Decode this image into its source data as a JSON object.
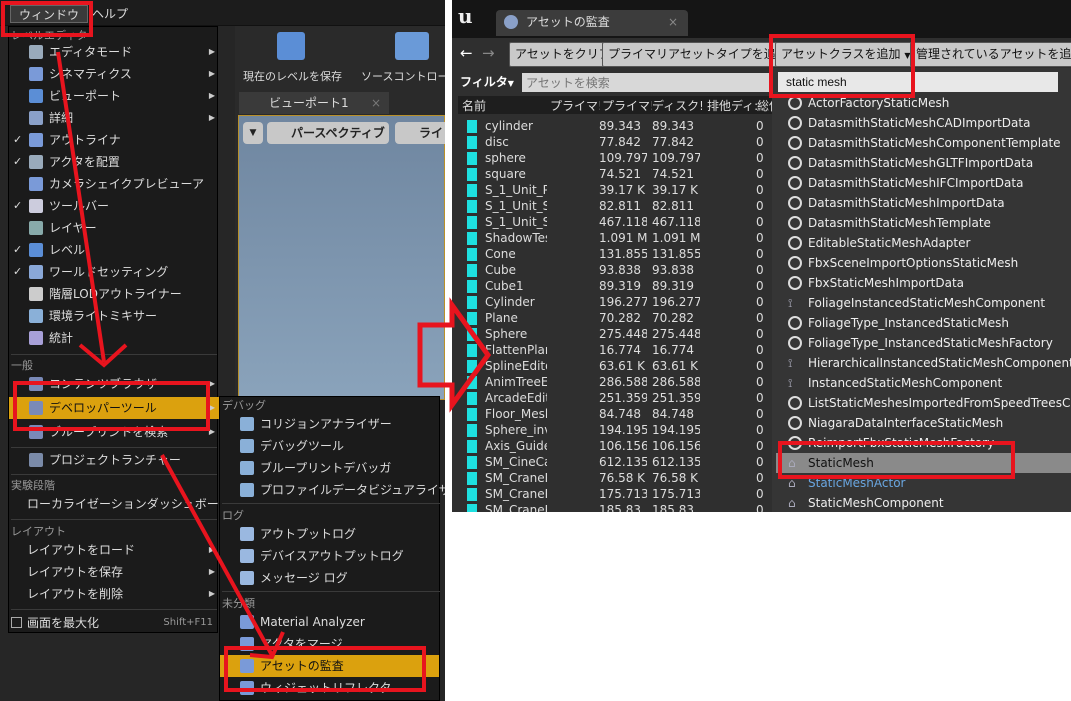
{
  "left": {
    "menubar": [
      "ウィンドウ",
      "ヘルプ"
    ],
    "toolbar": {
      "save": "現在のレベルを保存",
      "source": "ソースコントロー"
    },
    "viewport_tab": "ビューポート1",
    "viewport_buttons": [
      "パースペクティブ",
      "ライ"
    ],
    "menu": {
      "section_level_editor": "レベルエディタ",
      "items": [
        {
          "label": "エディタモード",
          "check": false,
          "submenu": true
        },
        {
          "label": "シネマティクス",
          "check": false,
          "submenu": true
        },
        {
          "label": "ビューポート",
          "check": false,
          "submenu": true
        },
        {
          "label": "詳細",
          "check": false,
          "submenu": true
        },
        {
          "label": "アウトライナ",
          "check": true,
          "submenu": false
        },
        {
          "label": "アクタを配置",
          "check": true,
          "submenu": false
        },
        {
          "label": "カメラシェイクプレビューア",
          "check": false,
          "submenu": false
        },
        {
          "label": "ツールバー",
          "check": true,
          "submenu": false
        },
        {
          "label": "レイヤー",
          "check": false,
          "submenu": false
        },
        {
          "label": "レベル",
          "check": true,
          "submenu": false
        },
        {
          "label": "ワールドセッティング",
          "check": true,
          "submenu": false
        },
        {
          "label": "階層LODアウトライナー",
          "check": false,
          "submenu": false
        },
        {
          "label": "環境ライトミキサー",
          "check": false,
          "submenu": false
        },
        {
          "label": "統計",
          "check": false,
          "submenu": false
        }
      ],
      "section_general": "一般",
      "general": [
        {
          "label": "コンテンツブラウザ"
        },
        {
          "label": "デベロッパーツール",
          "highlighted": true
        },
        {
          "label": "ブループリントを検索"
        }
      ],
      "project_launcher": "プロジェクトランチャー",
      "section_experimental": "実験段階",
      "localization": "ローカライゼーションダッシュボード",
      "section_layout": "レイアウト",
      "layout": [
        "レイアウトをロード",
        "レイアウトを保存",
        "レイアウトを削除"
      ],
      "maximize": "画面を最大化",
      "maximize_shortcut": "Shift+F11"
    },
    "submenu": {
      "section_debug": "デバッグ",
      "debug": [
        "コリジョンアナライザー",
        "デバッグツール",
        "ブループリントデバッガ",
        "プロファイルデータビジュアライザ"
      ],
      "section_log": "ログ",
      "log": [
        "アウトプットログ",
        "デバイスアウトプットログ",
        "メッセージ ログ"
      ],
      "section_misc": "未分類",
      "misc": [
        "Material Analyzer",
        "アクタをマージ",
        "アセットの監査",
        "ウィジェットリフレクタ"
      ]
    }
  },
  "right": {
    "tab_title": "アセットの監査",
    "buttons": [
      "アセットをクリア",
      "プライマリアセットタイプを追加",
      "アセットクラスを追加",
      "管理されているアセットを追加"
    ],
    "filter": "フィルタ",
    "search_placeholder": "アセットを検索",
    "columns": [
      "名前",
      "プライマ!",
      "プライマ!",
      "ディスク!",
      "排他ディ:",
      "総使"
    ],
    "rows": [
      [
        "cylinder",
        "89.343",
        "89.343",
        "0"
      ],
      [
        "disc",
        "77.842",
        "77.842",
        "0"
      ],
      [
        "sphere",
        "109.797",
        "109.797",
        "0"
      ],
      [
        "square",
        "74.521",
        "74.521",
        "0"
      ],
      [
        "S_1_Unit_Pl",
        "39.17 K",
        "39.17 K",
        "0"
      ],
      [
        "S_1_Unit_Sp",
        "82.811",
        "82.811",
        "0"
      ],
      [
        "S_1_Unit_Sp",
        "467.118",
        "467.118",
        "0"
      ],
      [
        "ShadowTes",
        "1.091 M",
        "1.091 M",
        "0"
      ],
      [
        "Cone",
        "131.855",
        "131.855",
        "0"
      ],
      [
        "Cube",
        "93.838",
        "93.838",
        "0"
      ],
      [
        "Cube1",
        "89.319",
        "89.319",
        "0"
      ],
      [
        "Cylinder",
        "196.277",
        "196.277",
        "0"
      ],
      [
        "Plane",
        "70.282",
        "70.282",
        "0"
      ],
      [
        "Sphere",
        "275.448",
        "275.448",
        "0"
      ],
      [
        "FlattenPlan",
        "16.774",
        "16.774",
        "0"
      ],
      [
        "SplineEdito",
        "63.61 K",
        "63.61 K",
        "0"
      ],
      [
        "AnimTreeEd",
        "286.588",
        "286.588",
        "0"
      ],
      [
        "ArcadeEdito",
        "251.359",
        "251.359",
        "0"
      ],
      [
        "Floor_Mesh",
        "84.748",
        "84.748",
        "0"
      ],
      [
        "Sphere_inve",
        "194.195",
        "194.195",
        "0"
      ],
      [
        "Axis_Guide",
        "106.156",
        "106.156",
        "0"
      ],
      [
        "SM_CineCa",
        "612.135",
        "612.135",
        "0"
      ],
      [
        "SM_CraneR",
        "76.58 K",
        "76.58 K",
        "0"
      ],
      [
        "SM_CraneR",
        "175.713",
        "175.713",
        "0"
      ],
      [
        "SM_CraneR",
        "185.83",
        "185.83",
        "0"
      ]
    ],
    "class_dropdown": {
      "search_value": "static mesh",
      "items": [
        {
          "label": "ActorFactoryStaticMesh",
          "icon": "circle"
        },
        {
          "label": "DatasmithStaticMeshCADImportData",
          "icon": "circle"
        },
        {
          "label": "DatasmithStaticMeshComponentTemplate",
          "icon": "circle"
        },
        {
          "label": "DatasmithStaticMeshGLTFImportData",
          "icon": "circle"
        },
        {
          "label": "DatasmithStaticMeshIFCImportData",
          "icon": "circle"
        },
        {
          "label": "DatasmithStaticMeshImportData",
          "icon": "circle"
        },
        {
          "label": "DatasmithStaticMeshTemplate",
          "icon": "circle"
        },
        {
          "label": "EditableStaticMeshAdapter",
          "icon": "circle"
        },
        {
          "label": "FbxSceneImportOptionsStaticMesh",
          "icon": "circle"
        },
        {
          "label": "FbxStaticMeshImportData",
          "icon": "circle"
        },
        {
          "label": "FoliageInstancedStaticMeshComponent",
          "icon": "component"
        },
        {
          "label": "FoliageType_InstancedStaticMesh",
          "icon": "circle"
        },
        {
          "label": "FoliageType_InstancedStaticMeshFactory",
          "icon": "circle"
        },
        {
          "label": "HierarchicalInstancedStaticMeshComponent",
          "icon": "component"
        },
        {
          "label": "InstancedStaticMeshComponent",
          "icon": "component"
        },
        {
          "label": "ListStaticMeshesImportedFromSpeedTreesCommandlet",
          "icon": "circle"
        },
        {
          "label": "NiagaraDataInterfaceStaticMesh",
          "icon": "circle"
        },
        {
          "label": "ReimportFbxStaticMeshFactory",
          "icon": "circle"
        },
        {
          "label": "StaticMesh",
          "icon": "house",
          "selected": true
        },
        {
          "label": "StaticMeshActor",
          "icon": "house",
          "blue": true
        },
        {
          "label": "StaticMeshComponent",
          "icon": "house"
        }
      ]
    }
  },
  "colors": {
    "menu_highlight": "#dba10e",
    "annotation": "#e8141e",
    "file_icon": "#1ee0e0"
  }
}
